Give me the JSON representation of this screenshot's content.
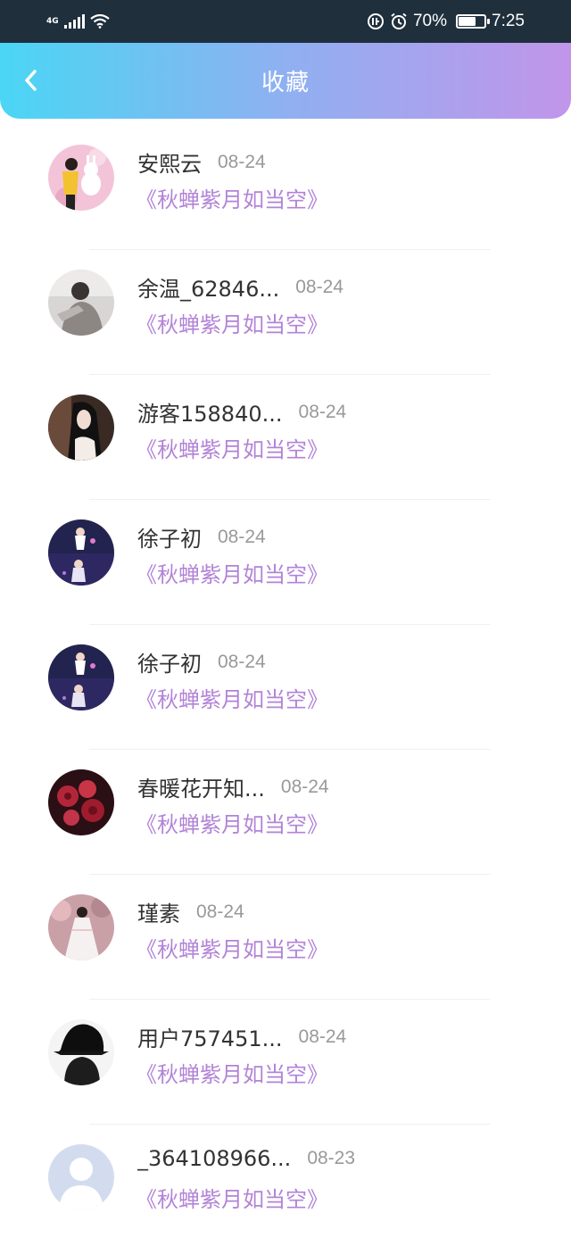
{
  "status_bar": {
    "network": "4G",
    "battery_text": "70%",
    "battery_level": 0.7,
    "time": "7:25"
  },
  "header": {
    "title": "收藏",
    "back_icon": "chevron-left-icon"
  },
  "colors": {
    "accent_purple": "#b283d7",
    "header_start": "#4ad6f4",
    "header_end": "#c195ea",
    "name_text": "#333333",
    "date_text": "#999999"
  },
  "items": [
    {
      "name": "安熙云",
      "date": "08-24",
      "novel": "《秋蝉紫月如当空》"
    },
    {
      "name": "余温_62846...",
      "date": "08-24",
      "novel": "《秋蝉紫月如当空》"
    },
    {
      "name": "游客158840...",
      "date": "08-24",
      "novel": "《秋蝉紫月如当空》"
    },
    {
      "name": "徐子初",
      "date": "08-24",
      "novel": "《秋蝉紫月如当空》"
    },
    {
      "name": "徐子初",
      "date": "08-24",
      "novel": "《秋蝉紫月如当空》"
    },
    {
      "name": "春暖花开知...",
      "date": "08-24",
      "novel": "《秋蝉紫月如当空》"
    },
    {
      "name": "瑾素",
      "date": "08-24",
      "novel": "《秋蝉紫月如当空》"
    },
    {
      "name": "用户757451...",
      "date": "08-24",
      "novel": "《秋蝉紫月如当空》"
    },
    {
      "name": "_364108966...",
      "date": "08-23",
      "novel": "《秋蝉紫月如当空》"
    }
  ]
}
